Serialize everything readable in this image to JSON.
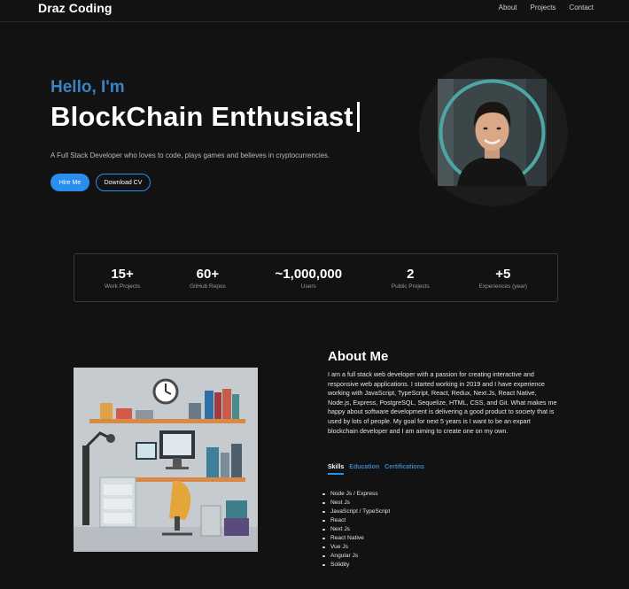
{
  "nav": {
    "brand": "Draz Coding",
    "links": [
      "About",
      "Projects",
      "Contact"
    ]
  },
  "hero": {
    "greeting": "Hello, I'm",
    "headline": "BlockChain Enthusiast",
    "tagline": "A Full Stack Developer who loves to code, plays games and believes in cryptocurrencies.",
    "hire_label": "Hire Me",
    "cv_label": "Download CV"
  },
  "stats": [
    {
      "value": "15+",
      "label": "Work Projects"
    },
    {
      "value": "60+",
      "label": "GitHub Repos"
    },
    {
      "value": "~1,000,000",
      "label": "Users"
    },
    {
      "value": "2",
      "label": "Public Projects"
    },
    {
      "value": "+5",
      "label": "Experiences (year)"
    }
  ],
  "about": {
    "title": "About Me",
    "text": "I am a full stack web developer with a passion for creating interactive and responsive web applications. I started working in 2019 and I have experience working with JavaScript, TypeScript, React, Redux, Next.Js, React Native, Node.js, Express, PostgreSQL, Sequelize, HTML, CSS, and Git. What makes me happy about software development is delivering a good product to society that is used by lots of people. My goal for next 5 years is I want to be an expart blockchain developer and I am aiming to create one on my own.",
    "tabs": [
      "Skills",
      "Education",
      "Certifications"
    ],
    "skills": [
      "Node Js / Express",
      "Nest Js",
      "JavaScript / TypeScript",
      "React",
      "Next Js",
      "React Native",
      "Vue Js",
      "Angular Js",
      "Solidity"
    ]
  },
  "colors": {
    "accent": "#2a8df0",
    "greeting": "#3b82c4",
    "background": "#121212"
  }
}
